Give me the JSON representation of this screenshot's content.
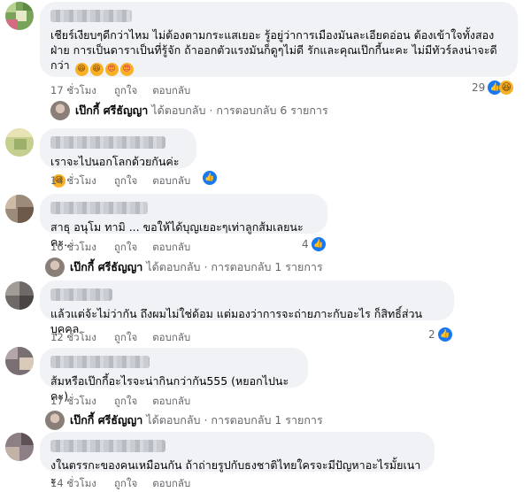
{
  "comments": [
    {
      "text": "เชียร์เงียบๆดีกว่าไหม ไม่ต้องตามกระแสเยอะ รู้อยู่ว่าการเมืองมันละเอียดอ่อน ต้องเข้าใจทั้งสองฝ่าย การเป็นดาราเป็นที่รู้จัก ถ้าออกตัวแรงมันก็ดูๆไม่ดี รักและคุณเป๊กกี้นะคะ ไม่มีทัวร์ลงน่าจะดีกว่า",
      "emojis": [
        "haha",
        "haha",
        "love",
        "love"
      ],
      "time": "17 ชั่วโมง",
      "like": "ถูกใจ",
      "reply": "ตอบกลับ",
      "reaction_count": "29",
      "reactions": [
        "like",
        "haha"
      ],
      "replies": {
        "name": "เป๊กกี้ ศรีธัญญา",
        "action": "ได้ตอบกลับ",
        "count": "· การตอบกลับ 6 รายการ"
      }
    },
    {
      "text": "เราจะไปนอกโลกด้วยกันค่ะ",
      "emojis": [
        "haha"
      ],
      "time": "14 ชั่วโมง",
      "like": "ถูกใจ",
      "reply": "ตอบกลับ",
      "reaction_count": "",
      "reactions": [
        "like"
      ]
    },
    {
      "text": "สาธุ อนุโม ทามิ ... ขอให้ได้บุญเยอะๆเท่าลูกส้มเลยนะคะ...",
      "emojis": [],
      "time": "16 ชั่วโมง",
      "like": "ถูกใจ",
      "reply": "ตอบกลับ",
      "reaction_count": "4",
      "reactions": [
        "like"
      ],
      "replies": {
        "name": "เป๊กกี้ ศรีธัญญา",
        "action": "ได้ตอบกลับ",
        "count": "· การตอบกลับ 1 รายการ"
      }
    },
    {
      "text": "แล้วแต่จ้ะไม่ว่ากัน ถึงผมไม่ใช่ด้อม แต่มองว่าการจะถ่ายภาะกับอะไร ก็สิทธิ์ส่วนบุคคล",
      "emojis": [],
      "time": "12 ชั่วโมง",
      "like": "ถูกใจ",
      "reply": "ตอบกลับ",
      "reaction_count": "2",
      "reactions": [
        "like"
      ]
    },
    {
      "text": "ส้มหรือเป๊กกี้อะไรจะน่ากินกว่ากัน555 (หยอกไปนะคะ)",
      "emojis": [],
      "time": "17 ชั่วโมง",
      "like": "ถูกใจ",
      "reply": "ตอบกลับ",
      "reaction_count": "",
      "reactions": [],
      "replies": {
        "name": "เป๊กกี้ ศรีธัญญา",
        "action": "ได้ตอบกลับ",
        "count": "· การตอบกลับ 1 รายการ"
      }
    },
    {
      "text": "งในตรรกะของคนเหมือนกัน ถ้าถ่ายรูปกับธงชาติไทยใครจะมีปัญหาอะไรมั้ยเนาะ",
      "emojis": [],
      "time": "14 ชั่วโมง",
      "like": "ถูกใจ",
      "reply": "ตอบกลับ",
      "reaction_count": "",
      "reactions": []
    }
  ],
  "colors": {
    "bubble": "#f0f2f5",
    "meta": "#65676b",
    "like_blue": "#1877f2",
    "emoji_yellow": "#f7b125"
  }
}
